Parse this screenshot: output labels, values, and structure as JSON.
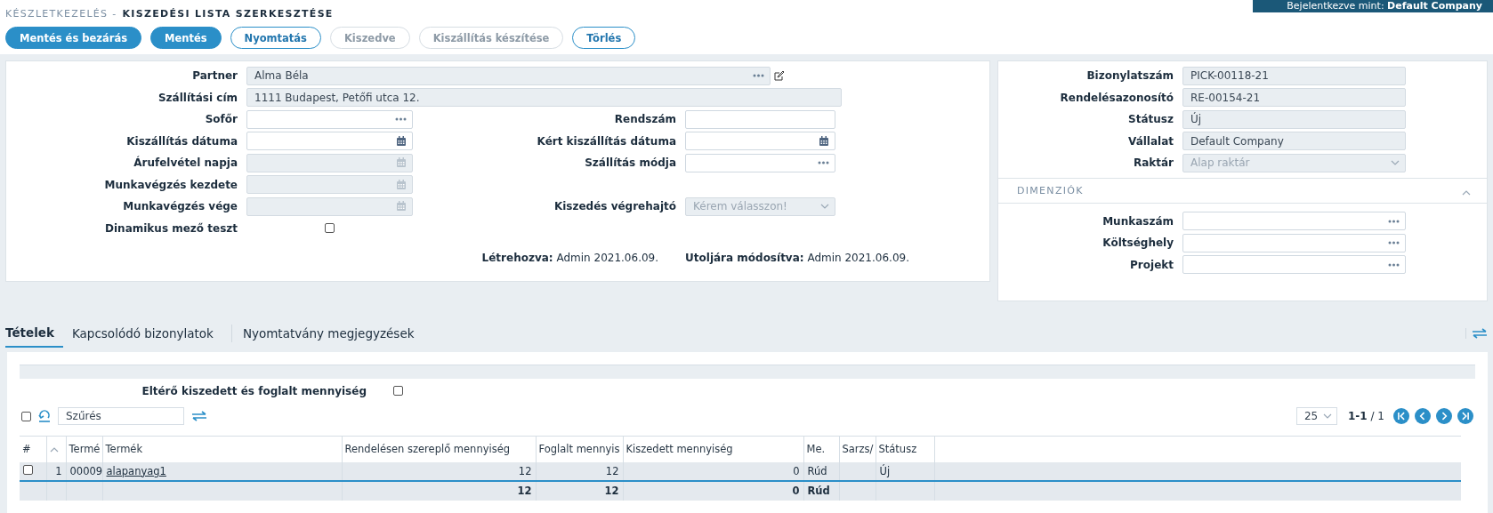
{
  "header": {
    "module": "KÉSZLETKEZELÉS -",
    "title": "KISZEDÉSI LISTA SZERKESZTÉSE",
    "login_label": "Bejelentkezve mint:",
    "login_user": "Default Company"
  },
  "toolbar": [
    {
      "label": "Mentés és bezárás",
      "kind": "primary",
      "disabled": false
    },
    {
      "label": "Mentés",
      "kind": "primary",
      "disabled": false
    },
    {
      "label": "Nyomtatás",
      "kind": "outline",
      "disabled": false
    },
    {
      "label": "Kiszedve",
      "kind": "outline",
      "disabled": true
    },
    {
      "label": "Kiszállítás készítése",
      "kind": "outline",
      "disabled": true
    },
    {
      "label": "Törlés",
      "kind": "outline",
      "disabled": false
    }
  ],
  "form": {
    "rows": [
      {
        "left": {
          "label": "Partner",
          "kind": "lookup",
          "value": "Alma Béla",
          "disabled": true,
          "wide": true,
          "editable": true
        }
      },
      {
        "left": {
          "label": "Szállítási cím",
          "kind": "text",
          "value": "1111 Budapest, Petőfi utca 12.",
          "disabled": true,
          "wide": true
        }
      },
      {
        "left": {
          "label": "Sofőr",
          "kind": "lookup",
          "disabled": false
        },
        "right": {
          "label": "Rendszám",
          "kind": "text",
          "disabled": false
        }
      },
      {
        "left": {
          "label": "Kiszállítás dátuma",
          "kind": "date",
          "disabled": false
        },
        "right": {
          "label": "Kért kiszállítás dátuma",
          "kind": "date",
          "disabled": false
        }
      },
      {
        "left": {
          "label": "Árufelvétel napja",
          "kind": "date",
          "disabled": true
        },
        "right": {
          "label": "Szállítás módja",
          "kind": "lookup",
          "disabled": false
        }
      },
      {
        "left": {
          "label": "Munkavégzés kezdete",
          "kind": "date",
          "disabled": true
        }
      },
      {
        "left": {
          "label": "Munkavégzés vége",
          "kind": "date",
          "disabled": true
        },
        "right": {
          "label": "Kiszedés végrehajtó",
          "kind": "select",
          "placeholder": "Kérem válasszon!",
          "disabled": true
        }
      },
      {
        "left": {
          "label": "Dinamikus mező teszt",
          "kind": "checkbox",
          "checked": false
        }
      }
    ],
    "created": "**Létrehozva:** Admin 2021.06.09.",
    "modified": "**Utoljára módosítva:** Admin 2021.06.09."
  },
  "details": {
    "fields": [
      {
        "label": "Bizonylatszám",
        "kind": "text",
        "value": "PICK-00118-21",
        "disabled": true
      },
      {
        "label": "Rendelésazonosító",
        "kind": "text",
        "value": "RE-00154-21",
        "disabled": true
      },
      {
        "label": "Státusz",
        "kind": "text",
        "value": "Új",
        "disabled": true
      },
      {
        "label": "Vállalat",
        "kind": "text",
        "value": "Default Company",
        "disabled": true
      },
      {
        "label": "Raktár",
        "kind": "select",
        "placeholder": "Alap raktár",
        "disabled": true
      }
    ],
    "dimensions": {
      "title": "DIMENZIÓK",
      "expanded": true,
      "fields": [
        {
          "label": "Munkaszám",
          "kind": "lookup",
          "disabled": false
        },
        {
          "label": "Költséghely",
          "kind": "lookup",
          "disabled": false
        },
        {
          "label": "Projekt",
          "kind": "lookup",
          "disabled": false
        }
      ]
    }
  },
  "tabs": [
    {
      "label": "Tételek",
      "selected": true
    },
    {
      "label": "Kapcsolódó bizonylatok",
      "selected": false
    },
    {
      "label": "Nyomtatvány megjegyzések",
      "selected": false
    }
  ],
  "items": {
    "filter": {
      "label": "Eltérő kiszedett és foglalt mennyiség",
      "checked": false
    },
    "select_all": {
      "checked": false
    },
    "search": {
      "placeholder": "Szűrés"
    },
    "pagination": {
      "page_size": "25",
      "range": "1-1",
      "total": "/ 1"
    },
    "table": {
      "columns": [
        "#",
        "",
        "Termé",
        "Termék",
        "Rendelésen szereplő mennyiség",
        "Foglalt mennyis",
        "Kiszedett mennyiség",
        "Me.",
        "Sarzs/",
        "Státusz"
      ],
      "rows": [
        {
          "checked": false,
          "cells": [
            null,
            "1",
            "00009",
            "alapanyag1",
            "12",
            "12",
            "0",
            "Rúd",
            null,
            "Új"
          ]
        }
      ],
      "totals": {
        "ordered": "12",
        "reserved": "12",
        "picked": "0",
        "unit": "Rúd"
      }
    }
  }
}
